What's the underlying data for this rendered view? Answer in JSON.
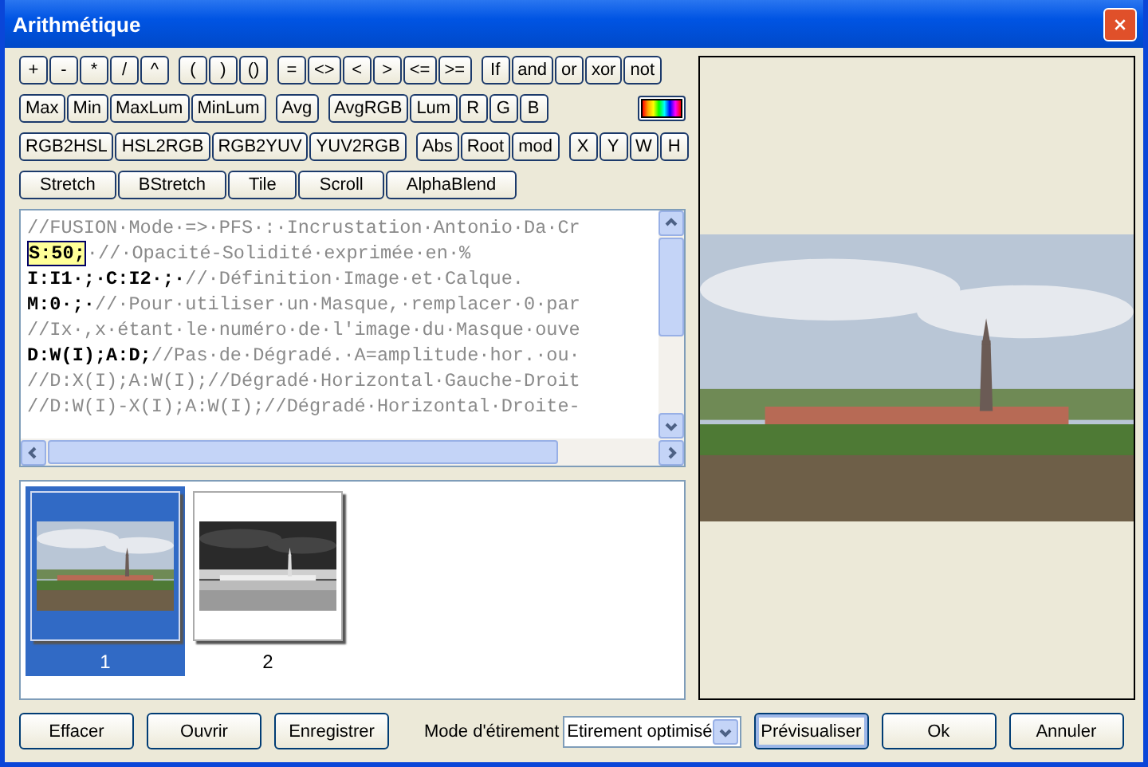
{
  "window": {
    "title": "Arithmétique"
  },
  "operator_rows": [
    [
      [
        "+",
        "-",
        "*",
        "/",
        "^"
      ],
      [
        "(",
        ")",
        "()"
      ],
      [
        "=",
        "<>",
        "<",
        ">",
        "<=",
        ">="
      ],
      [
        "If",
        "and",
        "or",
        "xor",
        "not"
      ]
    ],
    [
      [
        "Max",
        "Min",
        "MaxLum",
        "MinLum"
      ],
      [
        "Avg"
      ],
      [
        "AvgRGB",
        "Lum",
        "R",
        "G",
        "B"
      ]
    ],
    [
      [
        "RGB2HSL",
        "HSL2RGB",
        "RGB2YUV",
        "YUV2RGB"
      ],
      [
        "Abs",
        "Root",
        "mod"
      ],
      [
        "X",
        "Y",
        "W",
        "H"
      ]
    ],
    [
      [
        "Stretch",
        "BStretch",
        "Tile",
        "Scroll",
        "AlphaBlend"
      ]
    ]
  ],
  "editor_lines": [
    [
      {
        "kind": "comment",
        "text": "//FUSION·Mode·=>·PFS·:·Incrustation·Antonio·Da·Cr"
      }
    ],
    [
      {
        "kind": "highlight",
        "text": "S:50;"
      },
      {
        "kind": "comment",
        "text": "·//·Opacité-Solidité·exprimée·en·%"
      }
    ],
    [
      {
        "kind": "code",
        "text": "I:I1·;·C:I2·;·"
      },
      {
        "kind": "comment",
        "text": "//·Définition·Image·et·Calque."
      }
    ],
    [
      {
        "kind": "code",
        "text": "M:0·;·"
      },
      {
        "kind": "comment",
        "text": "//·Pour·utiliser·un·Masque,·remplacer·0·par"
      }
    ],
    [
      {
        "kind": "comment",
        "text": "//Ix·,x·étant·le·numéro·de·l'image·du·Masque·ouve"
      }
    ],
    [
      {
        "kind": "code",
        "text": "D:W(I);A:D;"
      },
      {
        "kind": "comment",
        "text": "//Pas·de·Dégradé.·A=amplitude·hor.·ou·"
      }
    ],
    [
      {
        "kind": "comment",
        "text": "//D:X(I);A:W(I);//Dégradé·Horizontal·Gauche-Droit"
      }
    ],
    [
      {
        "kind": "comment",
        "text": "//D:W(I)-X(I);A:W(I);//Dégradé·Horizontal·Droite-"
      }
    ]
  ],
  "thumbnails": [
    {
      "label": "1",
      "selected": true,
      "kind": "photo"
    },
    {
      "label": "2",
      "selected": false,
      "kind": "negative"
    }
  ],
  "left_buttons": [
    "Effacer",
    "Ouvrir",
    "Enregistrer"
  ],
  "stretch_mode": {
    "label": "Mode d'étirement",
    "value": "Etirement optimisé"
  },
  "right_buttons": [
    {
      "label": "Prévisualiser",
      "focused": true
    },
    {
      "label": "Ok",
      "focused": false
    },
    {
      "label": "Annuler",
      "focused": false
    }
  ]
}
